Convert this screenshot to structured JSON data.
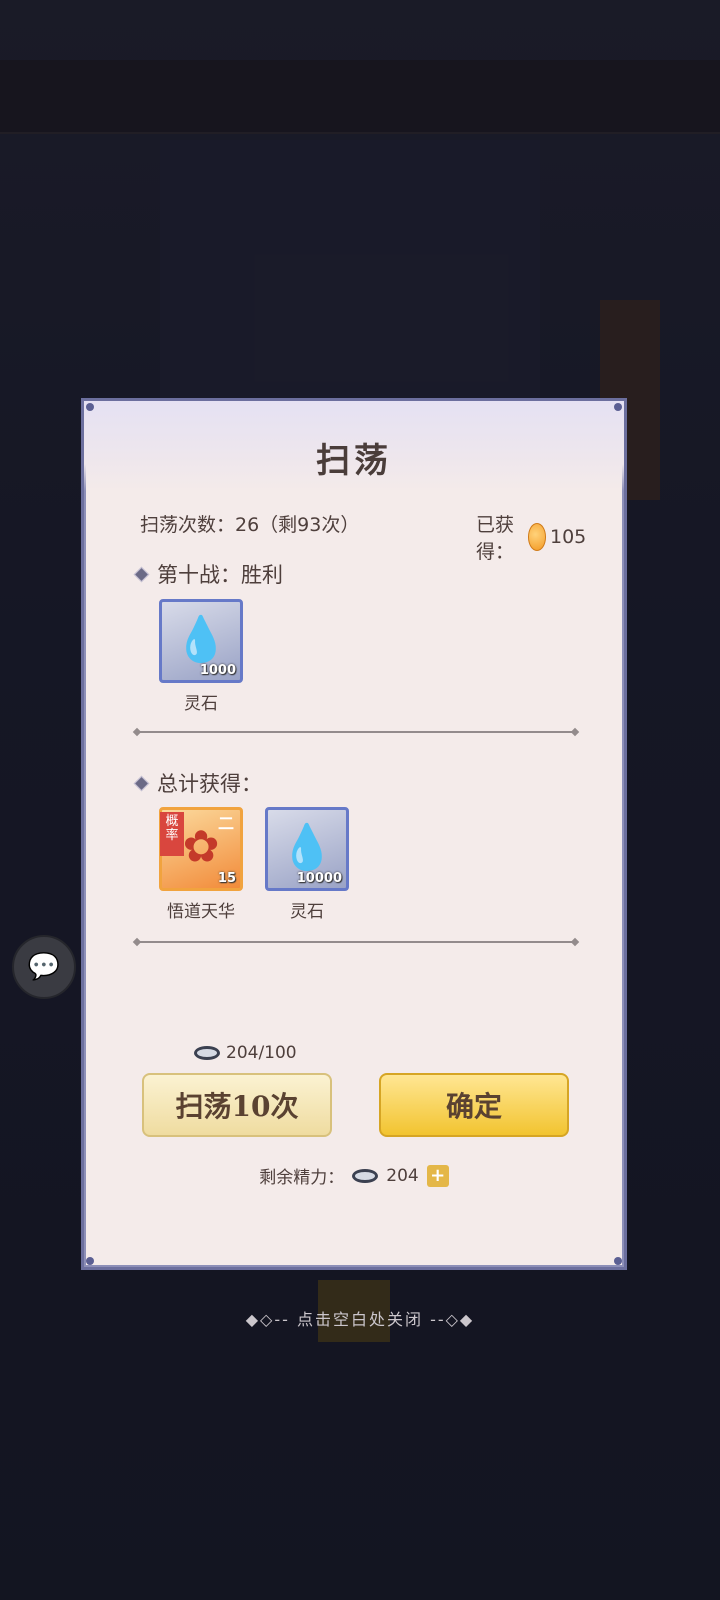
{
  "dialog": {
    "title": "扫荡",
    "sweep_count_text": "扫荡次数：26（剩93次）",
    "obtained_label": "已获得：",
    "obtained_value": "105",
    "battle_section": {
      "label": "第十战：胜利",
      "items": [
        {
          "name": "灵石",
          "qty": "1000",
          "icon": "spirit-stone-icon"
        }
      ]
    },
    "total_section": {
      "label": "总计获得：",
      "items": [
        {
          "name": "悟道天华",
          "qty": "15",
          "badge": "概率",
          "rank": "二",
          "icon": "enlightenment-flower-icon"
        },
        {
          "name": "灵石",
          "qty": "10000",
          "icon": "spirit-stone-icon"
        }
      ]
    },
    "cost_text": "204/100",
    "sweep_button_label": "扫荡10次",
    "confirm_button_label": "确定",
    "energy_label": "剩余精力：",
    "energy_value": "204"
  },
  "close_hint": "◆◇-- 点击空白处关闭 --◇◆"
}
